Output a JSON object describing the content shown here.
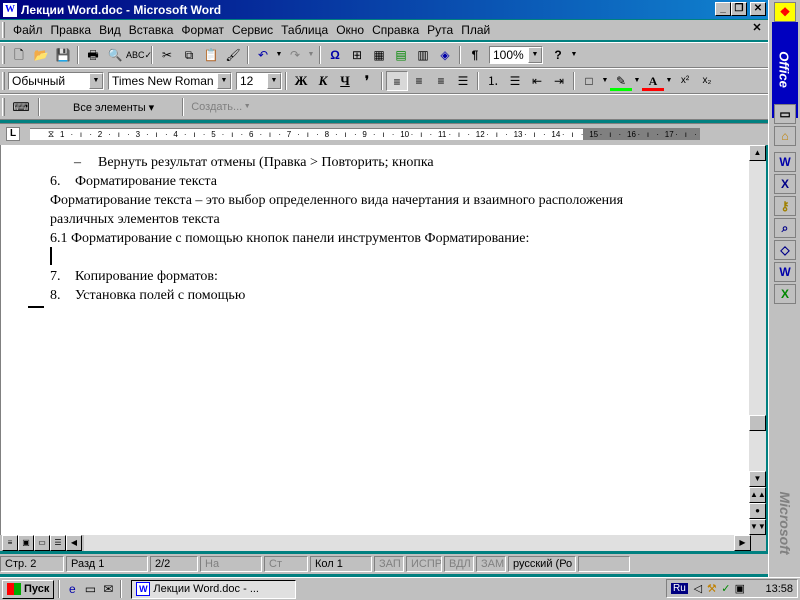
{
  "window": {
    "title": "Лекции Word.doc - Microsoft Word",
    "app_icon": "W"
  },
  "menu": [
    {
      "label": "Файл"
    },
    {
      "label": "Правка"
    },
    {
      "label": "Вид"
    },
    {
      "label": "Вставка"
    },
    {
      "label": "Формат"
    },
    {
      "label": "Сервис"
    },
    {
      "label": "Таблица"
    },
    {
      "label": "Окно"
    },
    {
      "label": "Справка"
    },
    {
      "label": "Рута"
    },
    {
      "label": "Плай"
    }
  ],
  "standard_toolbar": {
    "zoom": "100%"
  },
  "formatting_toolbar": {
    "style": "Обычный",
    "font": "Times New Roman",
    "size": "12",
    "bold": "Ж",
    "italic": "К",
    "underline": "Ч",
    "symbol_btn": "❜",
    "font_color_letter": "А"
  },
  "drawing_toolbar": {
    "all_elements": "Все элементы ▾",
    "create": "Создать..."
  },
  "ruler": {
    "ticks": [
      "1",
      "2",
      "3",
      "4",
      "5",
      "6",
      "7",
      "8",
      "9",
      "10",
      "11",
      "12",
      "13",
      "14",
      "15",
      "16",
      "17"
    ]
  },
  "document": {
    "lines": [
      {
        "type": "dash",
        "marker": "–",
        "text": "Вернуть результат отмены (Правка > Повторить; кнопка"
      },
      {
        "type": "num",
        "marker": "6.",
        "text": "Форматирование текста"
      },
      {
        "type": "plain",
        "text": "Форматирование текста – это выбор определенного вида начертания и взаимного расположения"
      },
      {
        "type": "plain",
        "text": "различных элементов текста"
      },
      {
        "type": "plain",
        "text": "6.1 Форматирование с помощью кнопок панели инструментов Форматирование:"
      },
      {
        "type": "empty",
        "text": ""
      },
      {
        "type": "num",
        "marker": "7.",
        "text": "Копирование форматов:"
      },
      {
        "type": "num",
        "marker": "8.",
        "text": "Установка полей с помощью"
      }
    ]
  },
  "statusbar": {
    "page": "Стр. 2",
    "section": "Разд 1",
    "pages": "2/2",
    "at": "На",
    "line": "Ст",
    "col": "Кол 1",
    "rec": "ЗАП",
    "trk": "ИСПР",
    "ext": "ВДЛ",
    "ovr": "ЗАМ",
    "language": "русский (Ро"
  },
  "officebar": {
    "logo": "Office",
    "brand": "Microsoft"
  },
  "taskbar": {
    "start": "Пуск",
    "task": "Лекции Word.doc - ...",
    "lang": "Ru",
    "clock": "13:58"
  }
}
